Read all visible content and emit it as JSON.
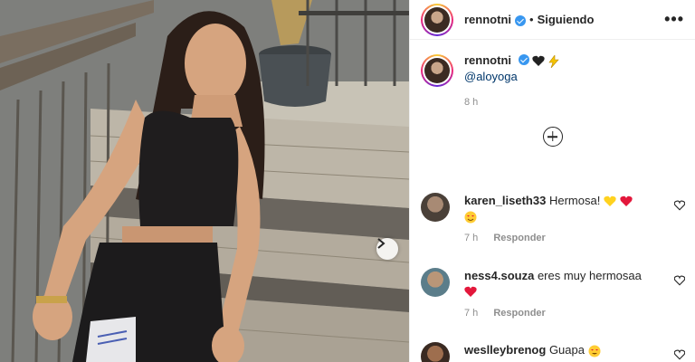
{
  "post": {
    "username": "rennotni",
    "follow_separator": "•",
    "follow_label": "Siguiendo",
    "more_label": "•••",
    "caption_mention": "@aloyoga",
    "caption_emojis": [
      "black-heart",
      "lightning"
    ],
    "posted_ago": "8 h"
  },
  "comments": [
    {
      "user": "karen_liseth33",
      "text": "Hermosa!",
      "emojis": [
        "yellow-heart",
        "red-heart",
        "smiling-heart-eyes-face"
      ],
      "time": "7 h",
      "reply_label": "Responder"
    },
    {
      "user": "ness4.souza",
      "text": "eres muy hermosaa",
      "emojis": [
        "red-heart"
      ],
      "time": "7 h",
      "reply_label": "Responder"
    },
    {
      "user": "weslleybrenog",
      "text": "Guapa",
      "emojis": [
        "heart-eyes-face"
      ],
      "time": "",
      "reply_label": ""
    }
  ],
  "colors": {
    "verified": "#3897f0",
    "mention": "#00376b",
    "meta": "#8e8e8e"
  }
}
